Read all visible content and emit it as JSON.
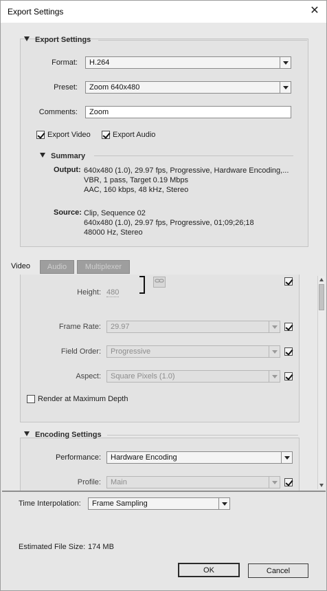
{
  "window": {
    "title": "Export Settings",
    "close_glyph": "✕"
  },
  "export_settings": {
    "header": "Export Settings",
    "format_label": "Format:",
    "format_value": "H.264",
    "preset_label": "Preset:",
    "preset_value": "Zoom 640x480",
    "comments_label": "Comments:",
    "comments_value": "Zoom",
    "export_video_label": "Export Video",
    "export_video_checked": true,
    "export_audio_label": "Export Audio",
    "export_audio_checked": true
  },
  "summary": {
    "header": "Summary",
    "output_label": "Output:",
    "output_lines": [
      "640x480 (1.0), 29.97 fps, Progressive, Hardware Encoding,...",
      "VBR, 1 pass, Target 0.19 Mbps",
      "AAC, 160 kbps, 48 kHz, Stereo"
    ],
    "source_label": "Source:",
    "source_lines": [
      "Clip, Sequence 02",
      "640x480 (1.0), 29.97 fps, Progressive, 01;09;26;18",
      "48000 Hz, Stereo"
    ]
  },
  "tabs": [
    {
      "label": "Video",
      "active": true
    },
    {
      "label": "Audio",
      "active": false
    },
    {
      "label": "Multiplexer",
      "active": false
    }
  ],
  "video": {
    "height_label": "Height:",
    "height_value": "480",
    "frame_rate_label": "Frame Rate:",
    "frame_rate_value": "29.97",
    "field_order_label": "Field Order:",
    "field_order_value": "Progressive",
    "aspect_label": "Aspect:",
    "aspect_value": "Square Pixels (1.0)",
    "render_max_depth_label": "Render at Maximum Depth",
    "render_max_depth_checked": false
  },
  "encoding": {
    "header": "Encoding Settings",
    "performance_label": "Performance:",
    "performance_value": "Hardware Encoding",
    "profile_label": "Profile:",
    "profile_value": "Main"
  },
  "footer": {
    "time_interpolation_label": "Time Interpolation:",
    "time_interpolation_value": "Frame Sampling",
    "estimated_size_label": "Estimated File Size:",
    "estimated_size_value": "174 MB",
    "ok_label": "OK",
    "cancel_label": "Cancel"
  },
  "icons": {
    "link": "link-icon",
    "collapse": "triangle-down-icon"
  }
}
